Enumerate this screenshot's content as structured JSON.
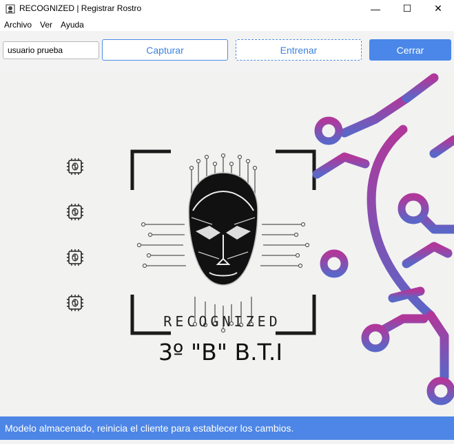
{
  "window": {
    "title": "RECOGNIZED | Registrar Rostro",
    "minimize_glyph": "—",
    "maximize_glyph": "☐",
    "close_glyph": "✕"
  },
  "menu": {
    "items": [
      "Archivo",
      "Ver",
      "Ayuda"
    ]
  },
  "toolbar": {
    "user_value": "usuario prueba",
    "capture_label": "Capturar",
    "train_label": "Entrenar",
    "close_label": "Cerrar"
  },
  "main": {
    "brand": "RECOGNIZED",
    "group_label": "3º \"B\" B.T.I",
    "chip_icon": "brain-chip-icon",
    "colors": {
      "accent": "#4a87e8",
      "circuit_start": "#b0389a",
      "circuit_end": "#5b66c7"
    }
  },
  "status": {
    "message": "Modelo almacenado, reinicia el cliente para establecer los cambios."
  }
}
